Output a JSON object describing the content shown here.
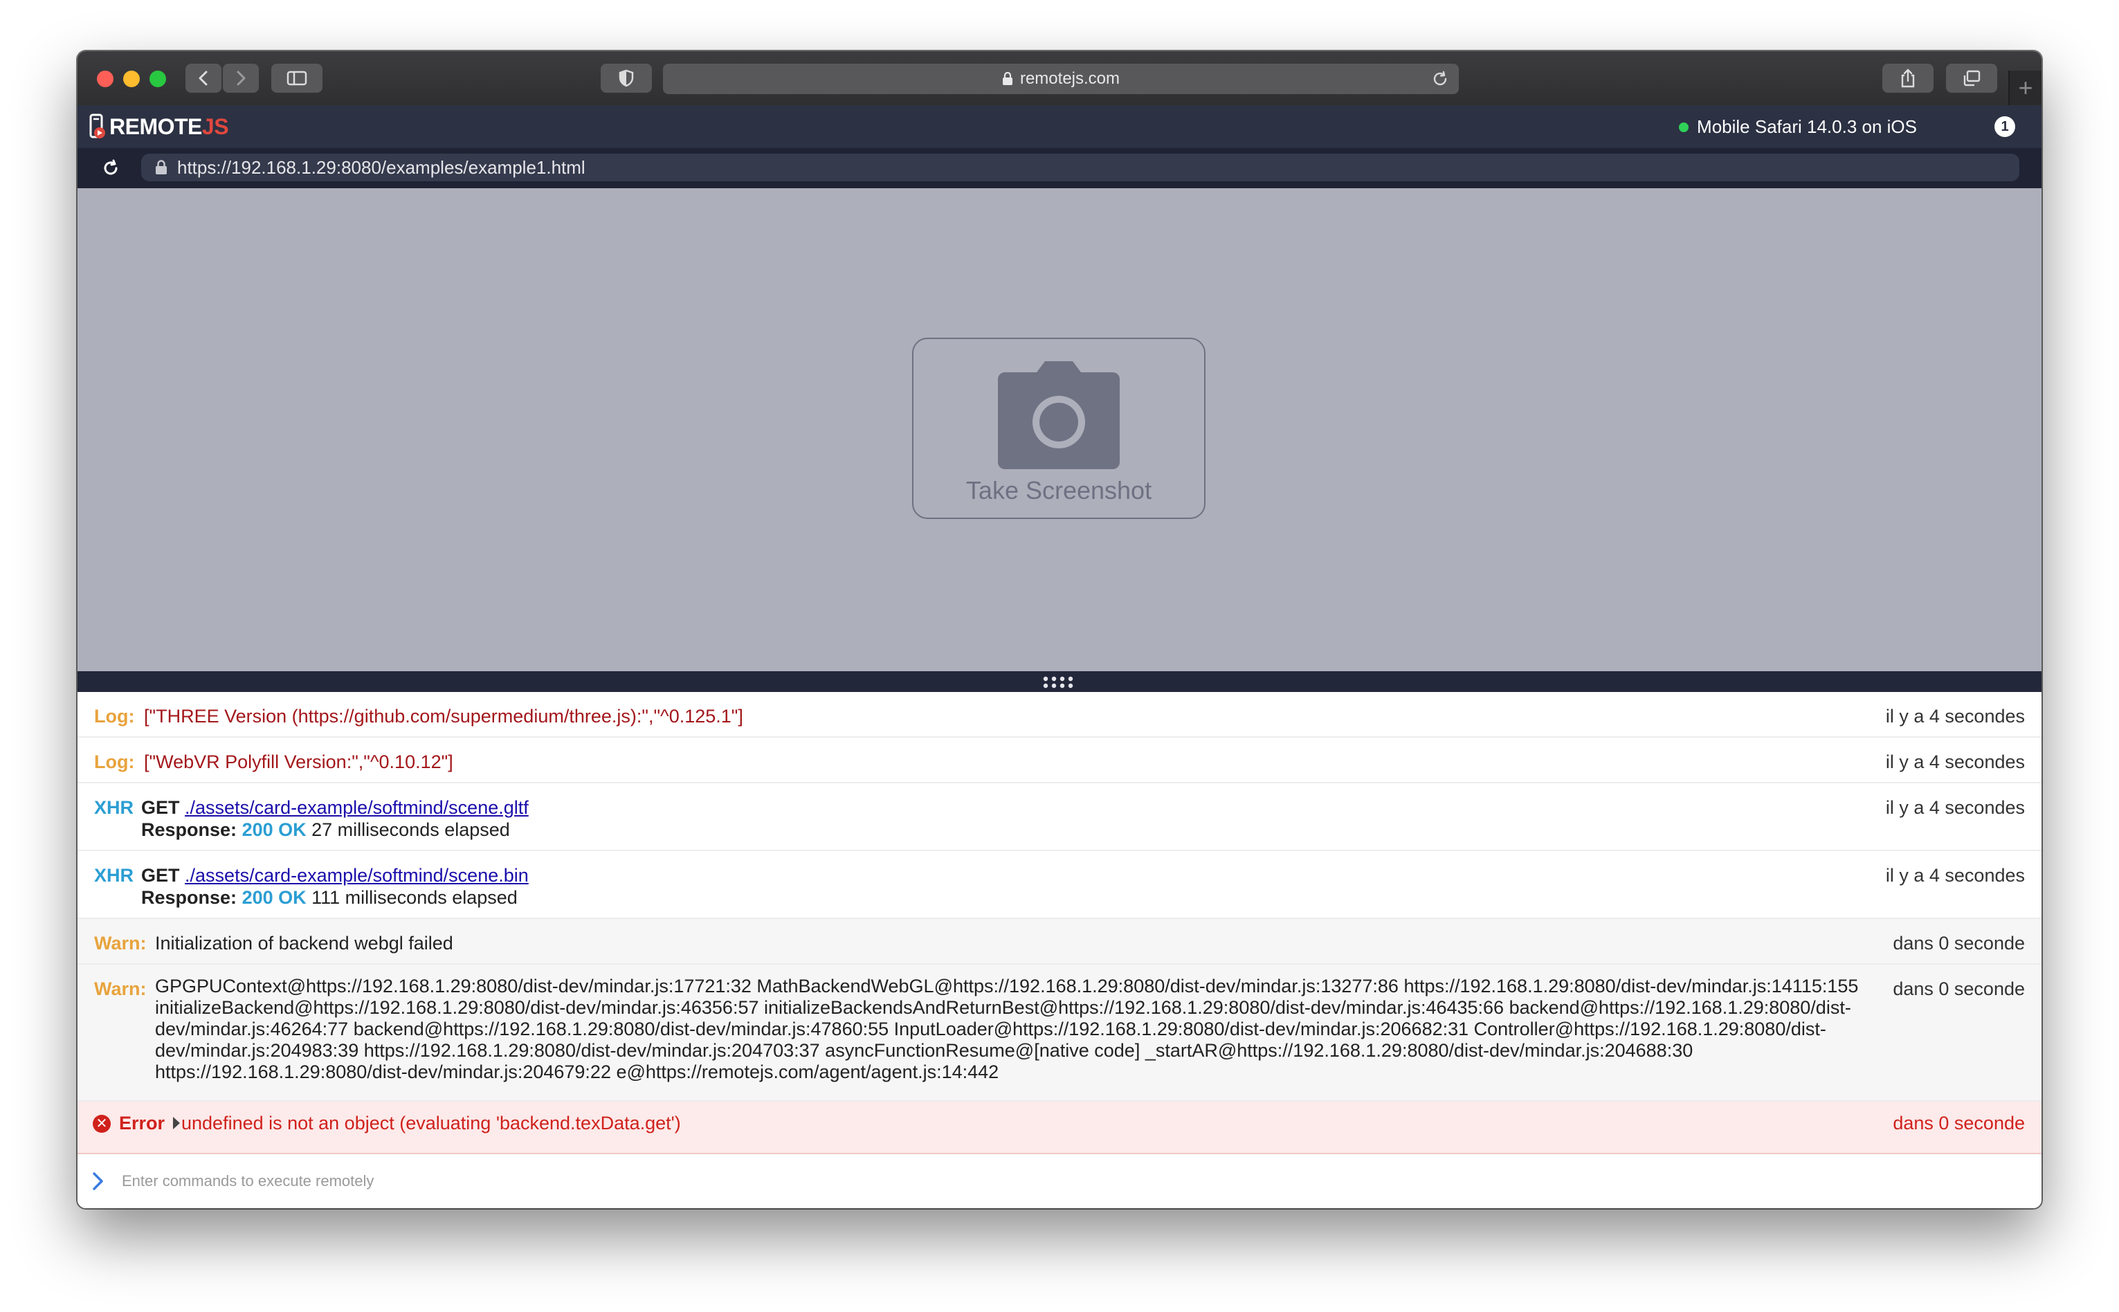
{
  "browser": {
    "address_text": "remotejs.com"
  },
  "app": {
    "logo_left": "REMOTE",
    "logo_right": "JS",
    "device": "Mobile Safari 14.0.3 on iOS",
    "device_count": "1",
    "url": "https://192.168.1.29:8080/examples/example1.html"
  },
  "screen": {
    "button_label": "Take Screenshot"
  },
  "console": {
    "rows": [
      {
        "kind": "Log:",
        "text": "[\"THREE Version (https://github.com/supermedium/three.js):\",\"^0.125.1\"]",
        "time": "il y a 4 secondes"
      },
      {
        "kind": "Log:",
        "text": "[\"WebVR Polyfill Version:\",\"^0.10.12\"]",
        "time": "il y a 4 secondes"
      },
      {
        "kind": "XHR",
        "method": "GET",
        "url": "./assets/card-example/softmind/scene.gltf",
        "response_label": "Response:",
        "status": "200 OK",
        "elapsed": "27 milliseconds elapsed",
        "time": "il y a 4 secondes"
      },
      {
        "kind": "XHR",
        "method": "GET",
        "url": "./assets/card-example/softmind/scene.bin",
        "response_label": "Response:",
        "status": "200 OK",
        "elapsed": "111 milliseconds elapsed",
        "time": "il y a 4 secondes"
      },
      {
        "kind": "Warn:",
        "text": "Initialization of backend webgl failed",
        "time": "dans 0 seconde"
      },
      {
        "kind": "Warn:",
        "text": "GPGPUContext@https://192.168.1.29:8080/dist-dev/mindar.js:17721:32 MathBackendWebGL@https://192.168.1.29:8080/dist-dev/mindar.js:13277:86 https://192.168.1.29:8080/dist-dev/mindar.js:14115:155 initializeBackend@https://192.168.1.29:8080/dist-dev/mindar.js:46356:57 initializeBackendsAndReturnBest@https://192.168.1.29:8080/dist-dev/mindar.js:46435:66 backend@https://192.168.1.29:8080/dist-dev/mindar.js:46264:77 backend@https://192.168.1.29:8080/dist-dev/mindar.js:47860:55 InputLoader@https://192.168.1.29:8080/dist-dev/mindar.js:206682:31 Controller@https://192.168.1.29:8080/dist-dev/mindar.js:204983:39 https://192.168.1.29:8080/dist-dev/mindar.js:204703:37 asyncFunctionResume@[native code] _startAR@https://192.168.1.29:8080/dist-dev/mindar.js:204688:30 https://192.168.1.29:8080/dist-dev/mindar.js:204679:22 e@https://remotejs.com/agent/agent.js:14:442",
        "time": "dans 0 seconde"
      },
      {
        "kind": "Error",
        "text": "undefined is not an object (evaluating 'backend.texData.get')",
        "time": "dans 0 seconde"
      }
    ],
    "command_placeholder": "Enter commands to execute remotely"
  },
  "colors": {
    "header_bg": "#2c3143",
    "urlbar_bg": "#1f2333",
    "screen_bg": "#adb0bb",
    "log_accent": "#e8a33d",
    "xhr_accent": "#2b9ed3",
    "error_red": "#d0211c",
    "logo_js": "#e0483e"
  },
  "icons": [
    "back-icon",
    "forward-icon",
    "sidebar-icon",
    "shield-icon",
    "lock-icon",
    "reload-icon",
    "share-icon",
    "tabs-icon",
    "plus-icon",
    "camera-icon",
    "grip-icon",
    "error-icon",
    "caret-right-icon",
    "chevron-right-icon"
  ]
}
